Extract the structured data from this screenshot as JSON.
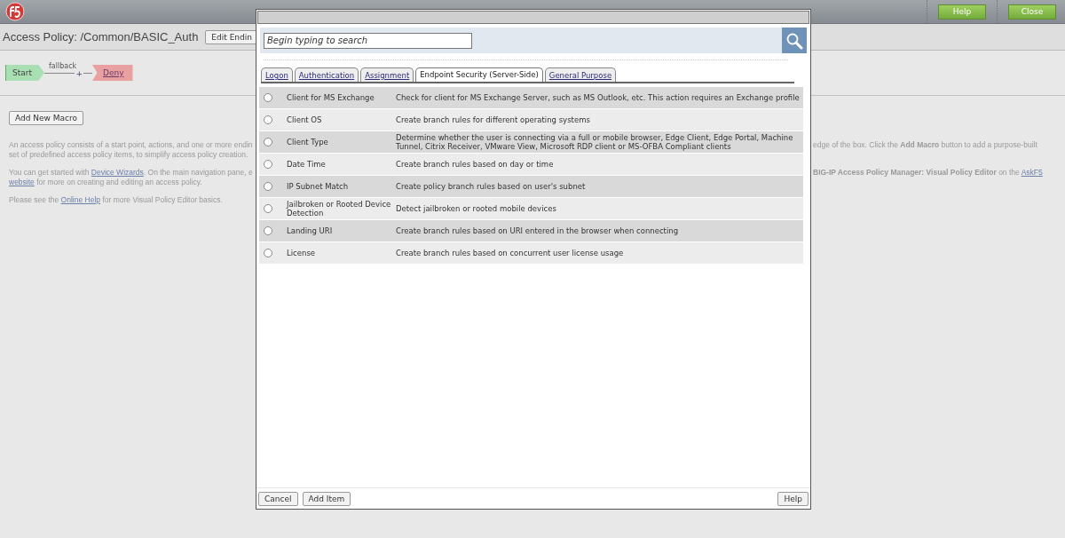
{
  "header": {
    "buttons": [
      "Help",
      "Close"
    ]
  },
  "policy": {
    "title": "Access Policy: /Common/BASIC_Auth",
    "edit_button": "Edit Endin"
  },
  "flow": {
    "start": "Start",
    "branch_label": "fallback",
    "add_symbol": "+",
    "ending": "Deny"
  },
  "add_macro_button": "Add New Macro",
  "intro": [
    {
      "left": [
        [
          {
            "kind": "text",
            "text": "An access policy consists of a start point, actions, and one or more endin"
          }
        ],
        [
          {
            "kind": "text",
            "text": "set of predefined access policy items, to simplify access policy creation."
          }
        ]
      ],
      "right": [
        [
          {
            "kind": "text",
            "text": "edge of the box. Click the **Add Macro** button to add a purpose-built"
          }
        ]
      ]
    },
    {
      "left": [
        [
          {
            "kind": "text",
            "text": "You can get started with "
          },
          {
            "kind": "link",
            "text": "Device Wizards"
          },
          {
            "kind": "text",
            "text": ". On the main navigation pane, e"
          }
        ],
        [
          {
            "kind": "link",
            "text": "website"
          },
          {
            "kind": "text",
            "text": " for more on creating and editing an access policy."
          }
        ]
      ],
      "right": [
        [
          {
            "kind": "text",
            "text": "**BIG-IP Access Policy Manager: Visual Policy Editor** on the "
          },
          {
            "kind": "link",
            "text": "AskF5"
          }
        ]
      ]
    },
    {
      "left": [
        [
          {
            "kind": "text",
            "text": "Please see the "
          },
          {
            "kind": "link",
            "text": "Online Help"
          },
          {
            "kind": "text",
            "text": " for more Visual Policy Editor basics."
          }
        ]
      ]
    }
  ],
  "dialog": {
    "search": {
      "placeholder": "Begin typing to search"
    },
    "tabs": [
      {
        "label": "Logon",
        "selected": false
      },
      {
        "label": "Authentication",
        "selected": false
      },
      {
        "label": "Assignment",
        "selected": false
      },
      {
        "label": "Endpoint Security (Server-Side)",
        "selected": true
      },
      {
        "label": "General Purpose",
        "selected": false
      }
    ],
    "items": [
      {
        "name": "Client for MS Exchange",
        "description": "Check for client for MS Exchange Server, such as MS Outlook, etc. This action requires an Exchange profile",
        "selected": false
      },
      {
        "name": "Client OS",
        "description": "Create branch rules for different operating systems",
        "selected": false
      },
      {
        "name": "Client Type",
        "description": "Determine whether the user is connecting via a full or mobile browser, Edge Client, Edge Portal, Machine Tunnel, Citrix Receiver, VMware View, Microsoft RDP client or MS-OFBA Compliant clients",
        "selected": false
      },
      {
        "name": "Date Time",
        "description": "Create branch rules based on day or time",
        "selected": false
      },
      {
        "name": "IP Subnet Match",
        "description": "Create policy branch rules based on user's subnet",
        "selected": false
      },
      {
        "name": "Jailbroken or Rooted Device Detection",
        "description": "Detect jailbroken or rooted mobile devices",
        "selected": false
      },
      {
        "name": "Landing URI",
        "description": "Create branch rules based on URI entered in the browser when connecting",
        "selected": false
      },
      {
        "name": "License",
        "description": "Create branch rules based on concurrent user license usage",
        "selected": false
      }
    ],
    "footer_left": [
      "Cancel",
      "Add Item"
    ],
    "footer_right": [
      "Help"
    ]
  }
}
